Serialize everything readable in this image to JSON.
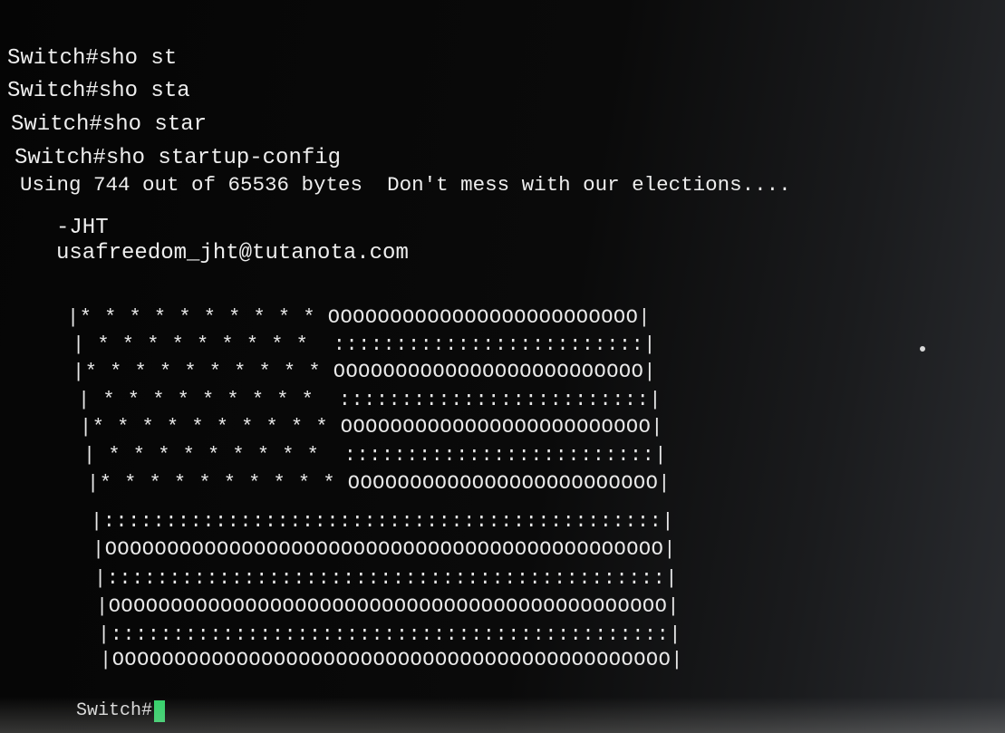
{
  "terminal": {
    "lines": [
      "Switch#sho st",
      "Switch#sho sta",
      "Switch#sho star",
      "Switch#sho startup-config",
      "Using 744 out of 65536 bytes  Don't mess with our elections....",
      "-JHT",
      "usafreedom_jht@tutanota.com"
    ],
    "flag_rows": [
      "|* * * * * * * * * * OOOOOOOOOOOOOOOOOOOOOOOOO|",
      "| * * * * * * * * *  :::::::::::::::::::::::::|",
      "|* * * * * * * * * * OOOOOOOOOOOOOOOOOOOOOOOOO|",
      "| * * * * * * * * *  :::::::::::::::::::::::::|",
      "|* * * * * * * * * * OOOOOOOOOOOOOOOOOOOOOOOOO|",
      "| * * * * * * * * *  :::::::::::::::::::::::::|",
      "|* * * * * * * * * * OOOOOOOOOOOOOOOOOOOOOOOOO|",
      "|:::::::::::::::::::::::::::::::::::::::::::::|",
      "|OOOOOOOOOOOOOOOOOOOOOOOOOOOOOOOOOOOOOOOOOOOOO|",
      "|:::::::::::::::::::::::::::::::::::::::::::::|",
      "|OOOOOOOOOOOOOOOOOOOOOOOOOOOOOOOOOOOOOOOOOOOOO|",
      "|:::::::::::::::::::::::::::::::::::::::::::::|",
      "|OOOOOOOOOOOOOOOOOOOOOOOOOOOOOOOOOOOOOOOOOOOOO|"
    ],
    "prompt": "Switch#",
    "cursor_color": "#34d26a"
  }
}
